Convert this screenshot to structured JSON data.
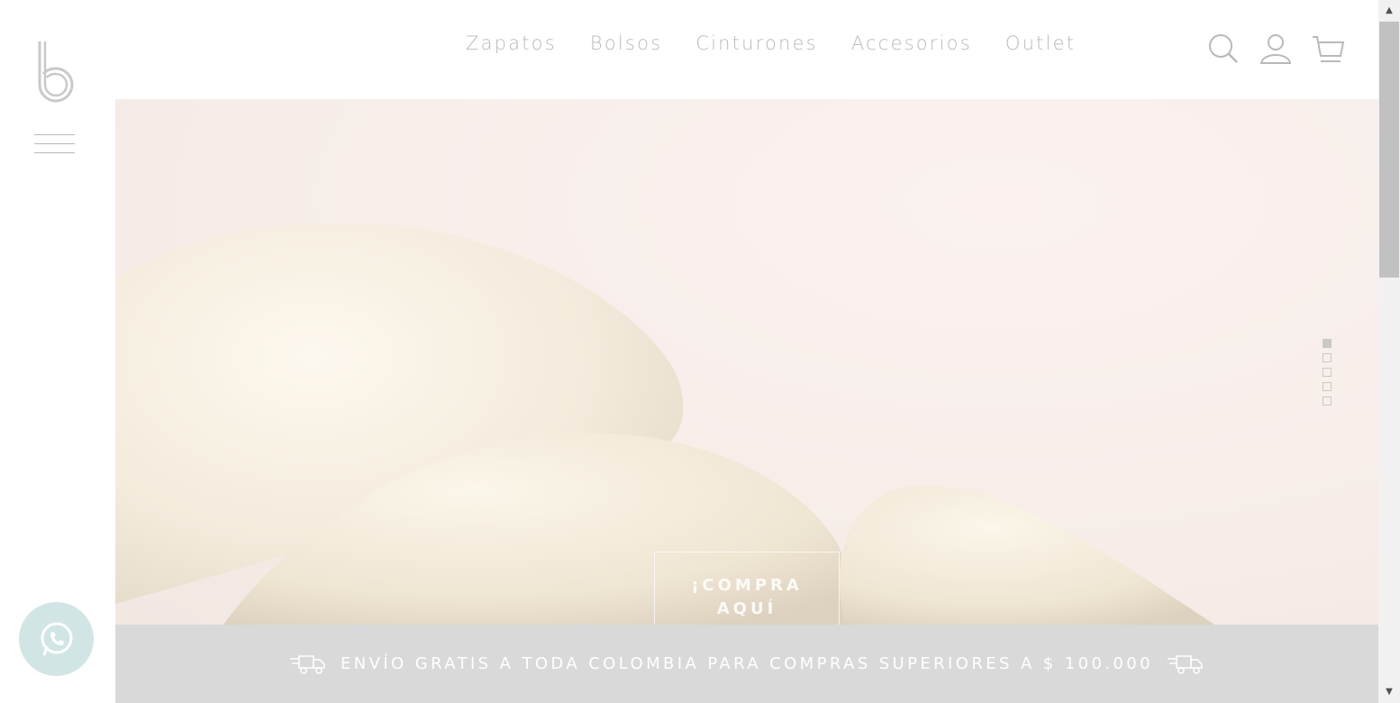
{
  "brand": {
    "logo_icon": "b-logo"
  },
  "nav": {
    "items": [
      {
        "label": "Zapatos"
      },
      {
        "label": "Bolsos"
      },
      {
        "label": "Cinturones"
      },
      {
        "label": "Accesorios"
      },
      {
        "label": "Outlet"
      }
    ]
  },
  "header_icons": [
    "search-icon",
    "user-icon",
    "cart-icon"
  ],
  "hero": {
    "cta_line1": "¡COMPRA",
    "cta_line2": "AQUÍ",
    "slides_total": 5,
    "active_slide": 1
  },
  "shipping_bar": {
    "text": "ENVÍO GRATIS A TODA COLOMBIA PARA COMPRAS SUPERIORES A $ 100.000"
  },
  "colors": {
    "accent_gray": "#b9b9b9",
    "ship_bar_bg": "#d9d9d9",
    "whatsapp_bg": "#d2e5e5"
  }
}
